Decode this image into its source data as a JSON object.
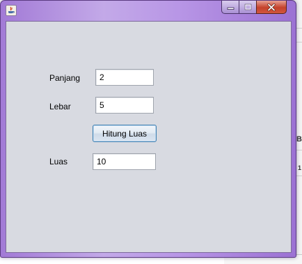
{
  "window": {
    "title": "",
    "controls": {
      "minimize": "minimize",
      "maximize": "maximize",
      "close": "close"
    }
  },
  "form": {
    "panjang": {
      "label": "Panjang",
      "value": "2"
    },
    "lebar": {
      "label": "Lebar",
      "value": "5"
    },
    "button_label": "Hitung Luas",
    "luas": {
      "label": "Luas",
      "value": "10"
    }
  },
  "background": {
    "glyph_a": "B",
    "glyph_b": "1"
  },
  "colors": {
    "client_bg": "#d8dae1",
    "frame": "#b896e6",
    "close_button": "#c4412b"
  }
}
